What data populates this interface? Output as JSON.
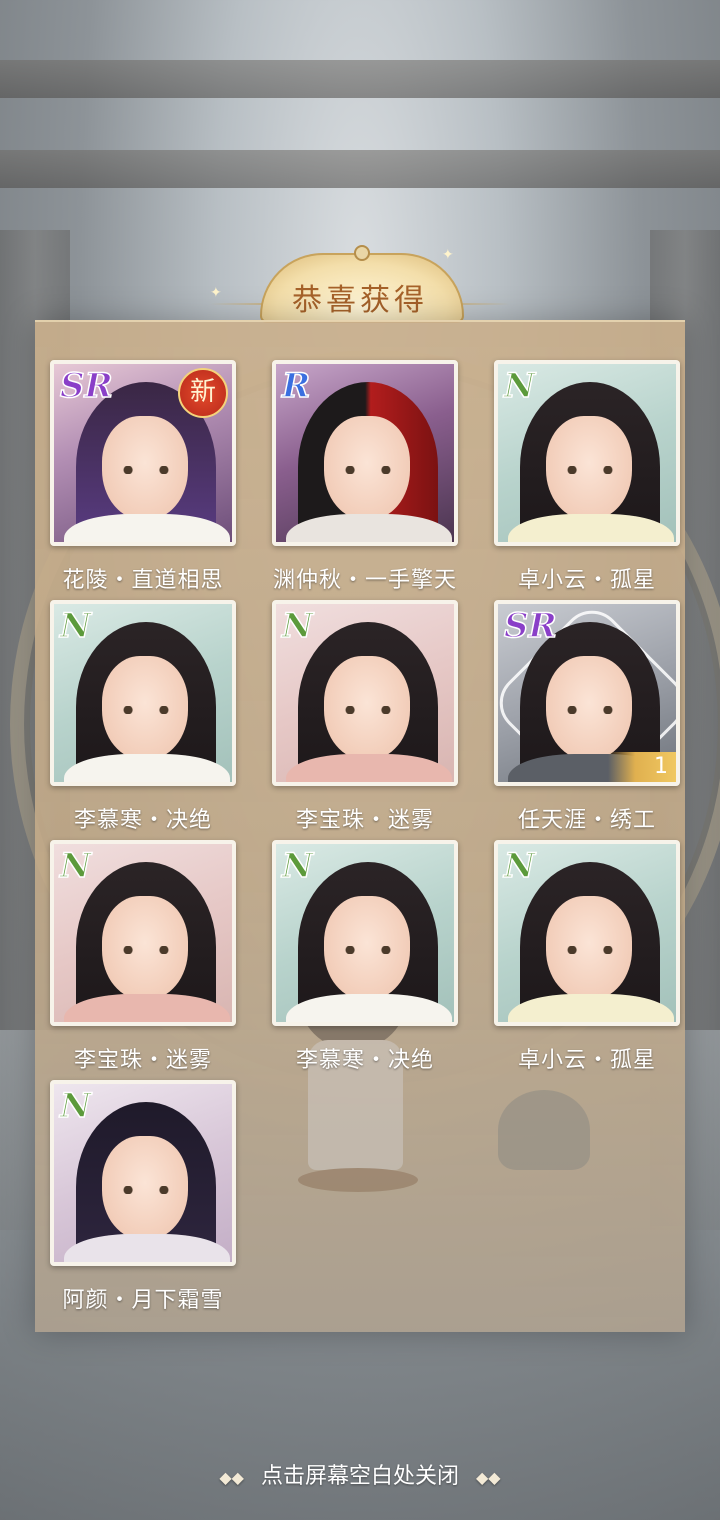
{
  "title": "恭喜获得",
  "cards": [
    {
      "rarity": "SR",
      "name": "花陵・直道相思",
      "new_badge": "新",
      "count": ""
    },
    {
      "rarity": "R",
      "name": "渊仲秋・一手擎天",
      "new_badge": "",
      "count": ""
    },
    {
      "rarity": "N",
      "name": "卓小云・孤星",
      "new_badge": "",
      "count": ""
    },
    {
      "rarity": "N",
      "name": "李慕寒・决绝",
      "new_badge": "",
      "count": ""
    },
    {
      "rarity": "N",
      "name": "李宝珠・迷雾",
      "new_badge": "",
      "count": ""
    },
    {
      "rarity": "SR",
      "name": "任天涯・绣工",
      "new_badge": "",
      "count": "1"
    },
    {
      "rarity": "N",
      "name": "李宝珠・迷雾",
      "new_badge": "",
      "count": ""
    },
    {
      "rarity": "N",
      "name": "李慕寒・决绝",
      "new_badge": "",
      "count": ""
    },
    {
      "rarity": "N",
      "name": "卓小云・孤星",
      "new_badge": "",
      "count": ""
    },
    {
      "rarity": "N",
      "name": "阿颜・月下霜雪",
      "new_badge": "",
      "count": ""
    }
  ],
  "footer": {
    "close_hint": "点击屏幕空白处关闭",
    "deco_left": "◆◆",
    "deco_right": "◆◆"
  }
}
